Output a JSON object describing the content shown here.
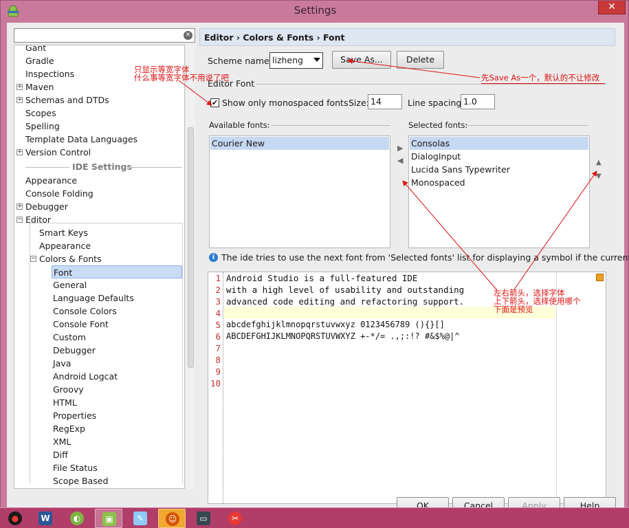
{
  "window": {
    "title": "Settings",
    "close_glyph": "✕"
  },
  "search": {
    "value": "",
    "placeholder": ""
  },
  "tree": {
    "items": [
      "Gant",
      "Gradle",
      "Inspections",
      "Maven",
      "Schemas and DTDs",
      "Scopes",
      "Spelling",
      "Template Data Languages",
      "Version Control"
    ],
    "section_label": "IDE Settings",
    "ide_items": [
      "Appearance",
      "Console Folding",
      "Debugger",
      "Editor"
    ],
    "editor_children": [
      "Smart Keys",
      "Appearance",
      "Colors & Fonts"
    ],
    "colors_fonts_children": [
      "Font",
      "General",
      "Language Defaults",
      "Console Colors",
      "Console Font",
      "Custom",
      "Debugger",
      "Java",
      "Android Logcat",
      "Groovy",
      "HTML",
      "Properties",
      "RegExp",
      "XML",
      "Diff",
      "File Status",
      "Scope Based"
    ],
    "selected": "Font"
  },
  "breadcrumb": {
    "text": "Editor › Colors & Fonts › Font"
  },
  "scheme": {
    "label": "Scheme name:",
    "value": "lizheng",
    "save_as_label": "Save As...",
    "delete_label": "Delete"
  },
  "editor_font": {
    "group_label": "Editor Font",
    "mono_checkbox_label": "Show only monospaced fonts",
    "mono_checked": true,
    "size_label": "Size:",
    "size_value": "14",
    "spacing_label": "Line spacing:",
    "spacing_value": "1.0"
  },
  "available": {
    "label": "Available fonts:",
    "fonts": [
      "Courier New"
    ]
  },
  "selected_fonts": {
    "label": "Selected fonts:",
    "fonts": [
      "Consolas",
      "DialogInput",
      "Lucida Sans Typewriter",
      "Monospaced"
    ]
  },
  "info": {
    "text": "The ide tries to use the next font from 'Selected fonts' list for displaying a symbol if the current..."
  },
  "preview": {
    "line_numbers": [
      "1",
      "2",
      "3",
      "4",
      "5",
      "6",
      "7",
      "8",
      "9",
      "10"
    ],
    "lines": [
      "Android Studio is a full-featured IDE",
      "with a high level of usability and outstanding",
      "advanced code editing and refactoring support.",
      "",
      "abcdefghijklmnopqrstuvwxyz 0123456789 (){}[]",
      "ABCDEFGHIJKLMNOPQRSTUVWXYZ +-*/= .,;:!? #&$%@|^"
    ]
  },
  "annotations": {
    "mono_note_1": "只显示等宽字体",
    "mono_note_2": "什么事等宽字体不用说了吧",
    "saveas_note": "先Save As一个，默认的不让修改",
    "arrows_note_1": "左右箭头，选择字体",
    "arrows_note_2": "上下箭头，选择使用哪个",
    "arrows_note_3": "下面是预览"
  },
  "buttons": {
    "ok": "OK",
    "cancel": "Cancel",
    "apply": "Apply",
    "help": "Help"
  },
  "colors": {
    "accent": "#c8302f",
    "annotation": "#e01010",
    "selection": "#c5d9f3"
  }
}
